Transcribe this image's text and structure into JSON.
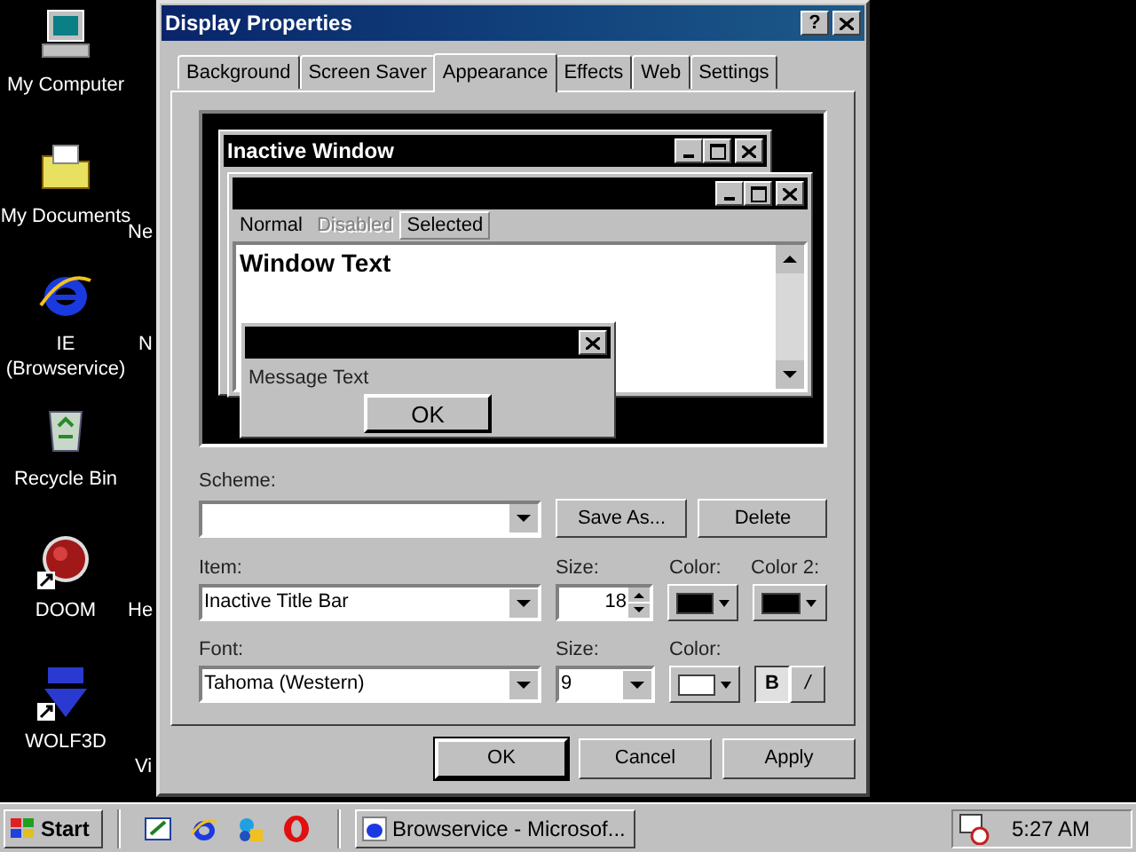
{
  "desktop_icons": [
    {
      "label": "My Computer",
      "kind": "computer"
    },
    {
      "label": "My Documents",
      "kind": "documents"
    },
    {
      "label": "IE\n(Browservice)",
      "kind": "browser"
    },
    {
      "label": "Recycle Bin",
      "kind": "recycle"
    },
    {
      "label": "DOOM",
      "kind": "doom"
    },
    {
      "label": "WOLF3D",
      "kind": "wolf"
    }
  ],
  "partial_icon_labels": [
    "Ne",
    "N",
    "He",
    "Vi"
  ],
  "dialog": {
    "title": "Display Properties",
    "help_button": "?",
    "tabs": [
      {
        "label": "Background",
        "selected": false
      },
      {
        "label": "Screen Saver",
        "selected": false
      },
      {
        "label": "Appearance",
        "selected": true
      },
      {
        "label": "Effects",
        "selected": false
      },
      {
        "label": "Web",
        "selected": false
      },
      {
        "label": "Settings",
        "selected": false
      }
    ],
    "preview": {
      "inactive_title": "Inactive Window",
      "menu": [
        {
          "label": "Normal",
          "selected": false,
          "disabled": false
        },
        {
          "label": "Disabled",
          "selected": false,
          "disabled": true
        },
        {
          "label": "Selected",
          "selected": true,
          "disabled": false
        }
      ],
      "window_text": "Window Text",
      "message_text": "Message Text",
      "ok_button": "OK"
    },
    "scheme": {
      "label": "Scheme:"
    },
    "scheme_buttons": [
      "Save As...",
      "Delete"
    ],
    "item": {
      "label": "Item:",
      "value": "Inactive Title Bar"
    },
    "item_size": {
      "label": "Size:",
      "value": "18"
    },
    "item_color": {
      "label": "Color:",
      "color": "#000000"
    },
    "item_color2": {
      "label": "Color 2:",
      "color": "#000000"
    },
    "font": {
      "label": "Font:",
      "value": "Tahoma (Western)"
    },
    "font_size": {
      "label": "Size:",
      "value": "9"
    },
    "font_color": {
      "label": "Color:",
      "color": "#ffffff"
    },
    "bold": {
      "label": "B",
      "on": true
    },
    "italic": {
      "label": "/",
      "on": false
    },
    "buttons": [
      {
        "label": "OK",
        "default": true
      },
      {
        "label": "Cancel",
        "default": false
      },
      {
        "label": "Apply",
        "default": false
      }
    ]
  },
  "taskbar": {
    "start": "Start",
    "quick_launch": [
      {
        "kind": "desktop"
      },
      {
        "kind": "browser"
      },
      {
        "kind": "channels"
      },
      {
        "kind": "opera"
      }
    ],
    "tasks": [
      {
        "label": "Browservice - Microsof...",
        "selected": false
      }
    ],
    "clock": "5:27 AM"
  }
}
